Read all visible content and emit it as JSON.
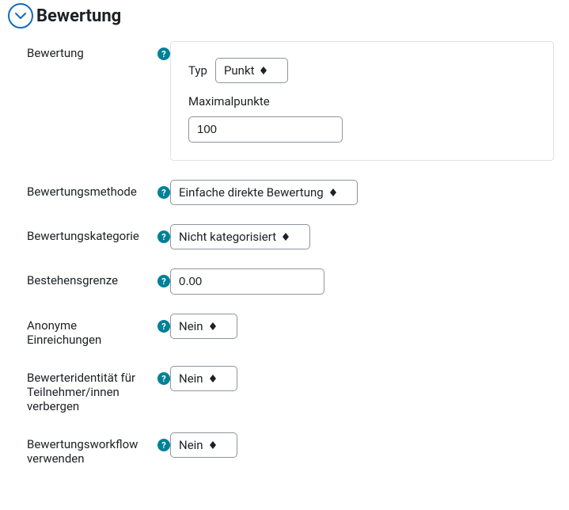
{
  "section": {
    "title": "Bewertung"
  },
  "rows": {
    "grade": {
      "label": "Bewertung",
      "type_label": "Typ",
      "type_value": "Punkt",
      "max_label": "Maximalpunkte",
      "max_value": "100"
    },
    "method": {
      "label": "Bewertungsmethode",
      "value": "Einfache direkte Bewertung"
    },
    "category": {
      "label": "Bewertungskategorie",
      "value": "Nicht kategorisiert"
    },
    "passgrade": {
      "label": "Bestehensgrenze",
      "value": "0.00"
    },
    "anon": {
      "label": "Anonyme Einreichungen",
      "value": "Nein"
    },
    "hideident": {
      "label": "Bewerteridentität für Teilnehmer/innen verbergen",
      "value": "Nein"
    },
    "workflow": {
      "label": "Bewertungsworkflow verwenden",
      "value": "Nein"
    }
  }
}
